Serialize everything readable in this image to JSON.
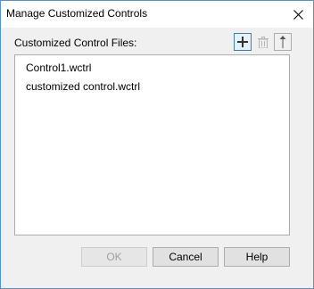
{
  "window": {
    "title": "Manage Customized Controls",
    "close_icon": "close-icon"
  },
  "files_section": {
    "label": "Customized Control Files:",
    "toolbar": {
      "add_icon": "plus-icon",
      "delete_icon": "trash-icon",
      "move_up_icon": "arrow-up-icon"
    },
    "items": [
      {
        "label": "Control1.wctrl"
      },
      {
        "label": "customized control.wctrl"
      }
    ]
  },
  "buttons": {
    "ok_label": "OK",
    "cancel_label": "Cancel",
    "help_label": "Help"
  },
  "colors": {
    "window_border": "#5a8fd0",
    "dialog_background": "#f0f0f0",
    "focus_border": "#3c7fb1"
  }
}
